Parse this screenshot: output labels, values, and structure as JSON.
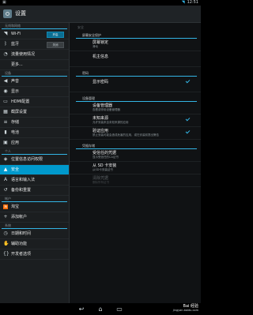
{
  "status_bar": {
    "time": "12:51",
    "left_icon": "settings-notification-icon",
    "wifi_icon": "wifi-signal-icon"
  },
  "action_bar": {
    "title": "设置",
    "icon": "settings-app-icon"
  },
  "left_pane": {
    "sections": [
      {
        "header": "无线和网络",
        "items": [
          {
            "label": "Wi-Fi",
            "icon": "wifi-icon",
            "toggle": "开启",
            "toggle_on": true
          },
          {
            "label": "蓝牙",
            "icon": "bluetooth-icon",
            "toggle": "关闭",
            "toggle_on": false
          },
          {
            "label": "流量使用情况",
            "icon": "data-usage-icon"
          },
          {
            "label": "更多...",
            "icon": ""
          }
        ]
      },
      {
        "header": "设备",
        "items": [
          {
            "label": "声音",
            "icon": "volume-icon"
          },
          {
            "label": "显示",
            "icon": "display-icon"
          },
          {
            "label": "HDMI配置",
            "icon": "hdmi-icon"
          },
          {
            "label": "截屏设置",
            "icon": "screenshot-icon"
          },
          {
            "label": "存储",
            "icon": "storage-icon"
          },
          {
            "label": "电池",
            "icon": "battery-icon"
          },
          {
            "label": "应用",
            "icon": "apps-icon"
          }
        ]
      },
      {
        "header": "个人",
        "items": [
          {
            "label": "位置信息访问权限",
            "icon": "location-icon"
          },
          {
            "label": "安全",
            "icon": "lock-icon",
            "selected": true
          },
          {
            "label": "语言和输入法",
            "icon": "language-icon"
          },
          {
            "label": "备份和重置",
            "icon": "backup-icon"
          }
        ]
      },
      {
        "header": "帐户",
        "items": [
          {
            "label": "淘宝",
            "icon": "taobao-icon"
          },
          {
            "label": "添加帐户",
            "icon": "add-icon"
          }
        ]
      },
      {
        "header": "系统",
        "items": [
          {
            "label": "日期和时间",
            "icon": "clock-icon"
          },
          {
            "label": "辅助功能",
            "icon": "accessibility-icon"
          },
          {
            "label": "开发者选项",
            "icon": "developer-icon"
          }
        ]
      }
    ]
  },
  "right_pane": {
    "top_label": "安全",
    "sections": [
      {
        "header": "屏幕安全保护",
        "items": [
          {
            "title": "屏幕锁定",
            "summary": "滑动"
          },
          {
            "title": "机主信息",
            "summary": ""
          }
        ]
      },
      {
        "header": "密码",
        "items": [
          {
            "title": "显示密码",
            "summary": "",
            "checked": true
          }
        ]
      },
      {
        "header": "设备管理",
        "items": [
          {
            "title": "设备管理器",
            "summary": "查看或停用设备管理器"
          },
          {
            "title": "未知来源",
            "summary": "允许安装来自未知来源的应用",
            "checked": true
          },
          {
            "title": "验证应用",
            "summary": "禁止安装可能会造成危害的应用，或在安装前提出警告",
            "checked": true
          }
        ]
      },
      {
        "header": "凭据存储",
        "items": [
          {
            "title": "受信任的凭据",
            "summary": "显示受信任的CA证书"
          },
          {
            "title": "从 SD 卡安装",
            "summary": "从SD卡安装证书"
          },
          {
            "title": "清除凭据",
            "summary": "删除所有证书",
            "disabled": true
          }
        ]
      }
    ]
  },
  "nav_bar": {
    "back_icon": "back-icon",
    "home_icon": "home-icon",
    "recents_icon": "recents-icon"
  },
  "watermark": {
    "line1": "Bai 经验",
    "line2": "jingyan.baidu.com"
  }
}
